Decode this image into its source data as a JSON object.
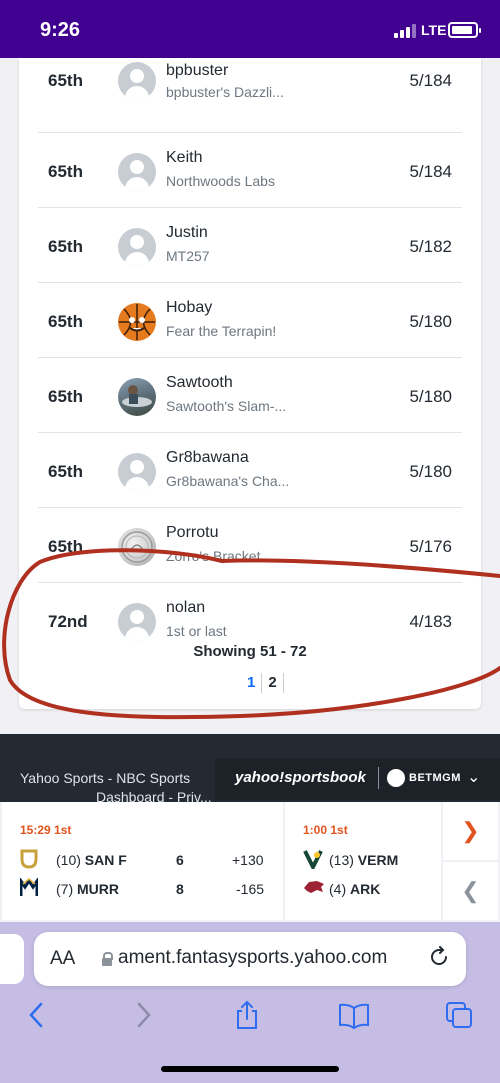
{
  "status_bar": {
    "time": "9:26",
    "network": "LTE"
  },
  "leaderboard": {
    "rows": [
      {
        "rank": "65th",
        "name": "bpbuster",
        "team": "bpbuster's Dazzli...",
        "score": "5/184",
        "avatar": "default-avatar-icon"
      },
      {
        "rank": "65th",
        "name": "Keith",
        "team": "Northwoods Labs",
        "score": "5/184",
        "avatar": "default-avatar-icon"
      },
      {
        "rank": "65th",
        "name": "Justin",
        "team": "MT257",
        "score": "5/182",
        "avatar": "default-avatar-icon"
      },
      {
        "rank": "65th",
        "name": "Hobay",
        "team": "Fear the Terrapin!",
        "score": "5/180",
        "avatar": "basketball-avatar"
      },
      {
        "rank": "65th",
        "name": "Sawtooth",
        "team": "Sawtooth's Slam-...",
        "score": "5/180",
        "avatar": "fish-photo-avatar"
      },
      {
        "rank": "65th",
        "name": "Gr8bawana",
        "team": "Gr8bawana's Cha...",
        "score": "5/180",
        "avatar": "default-avatar-icon"
      },
      {
        "rank": "65th",
        "name": "Porrotu",
        "team": "Zorro's Bracket",
        "score": "5/176",
        "avatar": "coin-avatar"
      },
      {
        "rank": "72nd",
        "name": "nolan",
        "team": "1st or last",
        "score": "4/183",
        "avatar": "default-avatar-icon"
      }
    ],
    "showing": "Showing 51 - 72",
    "pages": [
      "1",
      "2"
    ],
    "current_page": "1"
  },
  "footer": {
    "text_line1": "Yahoo Sports - NBC Sports",
    "text_line2": "Dashboard - Priv..."
  },
  "sportsbook": {
    "brand": "yahoo!sportsbook",
    "partner": "BETMGM"
  },
  "scores": {
    "game1": {
      "status": "15:29 1st",
      "team1": {
        "seed": "(10)",
        "name": "SAN F",
        "score": "6",
        "line": "+130"
      },
      "team2": {
        "seed": "(7)",
        "name": "MURR",
        "score": "8",
        "line": "-165"
      }
    },
    "game2": {
      "status": "1:00 1st",
      "team1": {
        "seed": "(13)",
        "name": "VERM"
      },
      "team2": {
        "seed": "(4)",
        "name": "ARK"
      }
    }
  },
  "browser": {
    "aa_label": "AA",
    "url": "ament.fantasysports.yahoo.com"
  },
  "colors": {
    "status_bar": "#400090",
    "accent_blue": "#0f69ff",
    "annotation_red": "#b03020",
    "live_orange": "#e0541f"
  }
}
